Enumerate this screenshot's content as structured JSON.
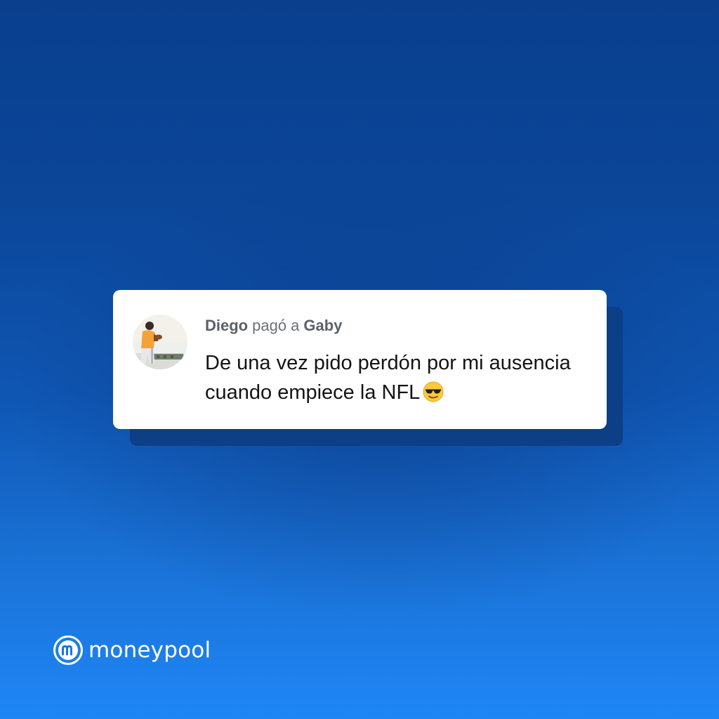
{
  "post": {
    "payer": "Diego",
    "verb": "pagó a",
    "payee": "Gaby",
    "message": "De una vez pido perdón por mi ausencia cuando empiece la NFL",
    "emoji_icon": "smiling-face-with-sunglasses-icon"
  },
  "brand": {
    "name": "moneypool",
    "logo_icon": "moneypool-m-logo-icon"
  },
  "colors": {
    "background_top": "#0a3f8e",
    "background_bottom": "#1f86f6",
    "card": "#ffffff",
    "card_shadow": "#0c3f86",
    "name_text": "#5b6168",
    "message_text": "#141414"
  }
}
